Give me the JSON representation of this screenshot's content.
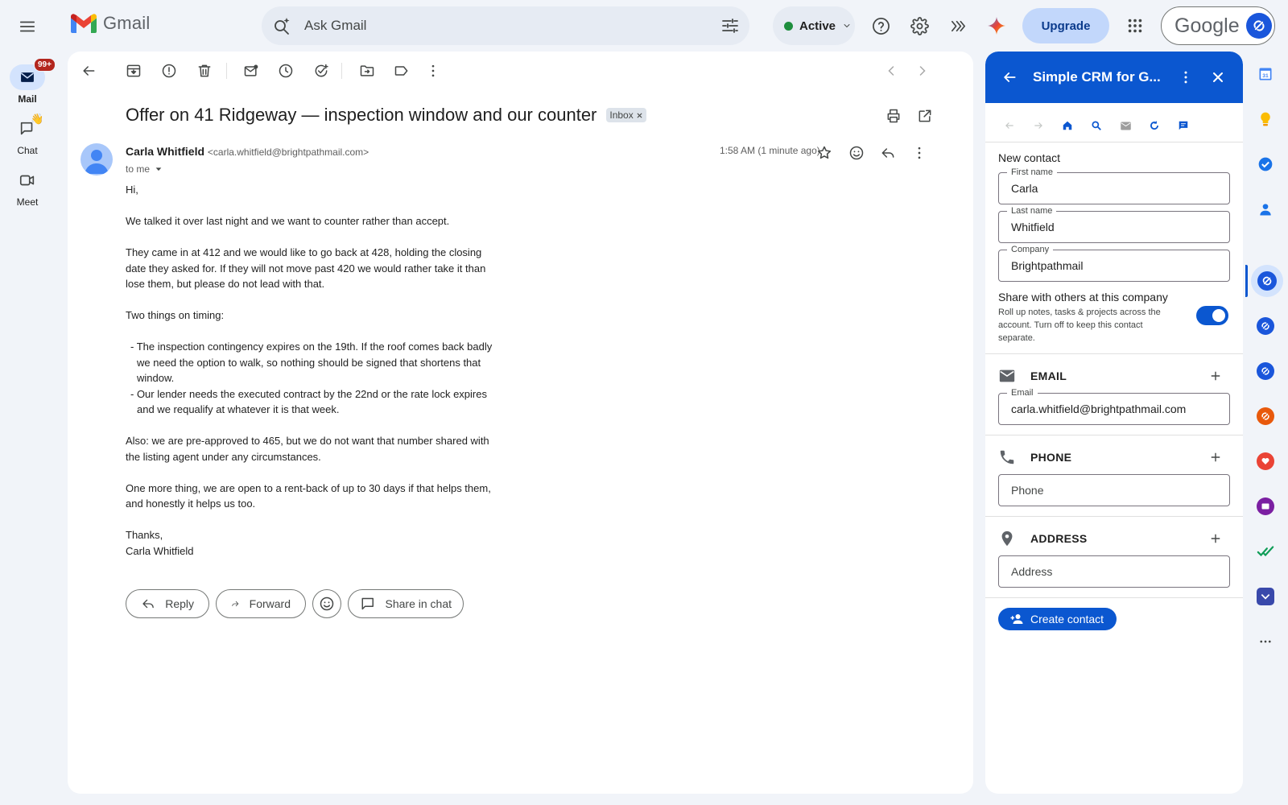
{
  "app": {
    "brand": "Gmail",
    "google": "Google"
  },
  "search": {
    "placeholder": "Ask Gmail"
  },
  "status": {
    "label": "Active"
  },
  "upgrade": {
    "label": "Upgrade"
  },
  "rail": {
    "mail": {
      "label": "Mail",
      "badge": "99+"
    },
    "chat": {
      "label": "Chat"
    },
    "meet": {
      "label": "Meet"
    }
  },
  "message": {
    "subject": "Offer on 41 Ridgeway — inspection window and our counter",
    "label_chip": "Inbox",
    "sender_name": "Carla Whitfield",
    "sender_email": "<carla.whitfield@brightpathmail.com>",
    "to": "to me",
    "time": "1:58 AM (1 minute ago)",
    "body": {
      "greeting": "Hi,",
      "p1": "We talked it over last night and we want to counter rather than accept.",
      "p2": "They came in at 412 and we would like to go back at 428, holding the closing date they asked for. If they will not move past 420 we would rather take it than lose them, but please do not lead with that.",
      "p3": "Two things on timing:",
      "bullet1": "- The inspection contingency expires on the 19th. If the roof comes back badly we need the option to walk, so nothing should be signed that shortens that window.",
      "bullet2": "- Our lender needs the executed contract by the 22nd or the rate lock expires and we requalify at whatever it is that week.",
      "p4": "Also: we are pre-approved to 465, but we do not want that number shared with the listing agent under any circumstances.",
      "p5": "One more thing, we are open to a rent-back of up to 30 days if that helps them, and honestly it helps us too.",
      "signoff": "Thanks,",
      "signature": "Carla Whitfield"
    },
    "actions": {
      "reply": "Reply",
      "forward": "Forward",
      "share": "Share in chat"
    }
  },
  "crm": {
    "title": "Simple CRM for G...",
    "section_new": "New contact",
    "first_name": {
      "label": "First name",
      "value": "Carla"
    },
    "last_name": {
      "label": "Last name",
      "value": "Whitfield"
    },
    "company": {
      "label": "Company",
      "value": "Brightpathmail"
    },
    "share": {
      "title": "Share with others at this company",
      "desc": "Roll up notes, tasks & projects across the account. Turn off to keep this contact separate.",
      "enabled": true
    },
    "email_section": {
      "title": "EMAIL",
      "field_label": "Email",
      "value": "carla.whitfield@brightpathmail.com"
    },
    "phone_section": {
      "title": "PHONE",
      "placeholder": "Phone"
    },
    "address_section": {
      "title": "ADDRESS",
      "placeholder": "Address"
    },
    "create_button": "Create contact"
  },
  "colors": {
    "accent": "#0b57d0",
    "unread_badge": "#b3261e",
    "active_dot": "#1e8e3e"
  },
  "side_icons": [
    "calendar-icon",
    "keep-icon",
    "tasks-icon",
    "contacts-icon",
    "simple-crm-icon",
    "addon-icon",
    "addon-icon",
    "addon-icon",
    "addon-icon",
    "addon-icon",
    "addon-icon",
    "addon-icon",
    "more-icon"
  ]
}
